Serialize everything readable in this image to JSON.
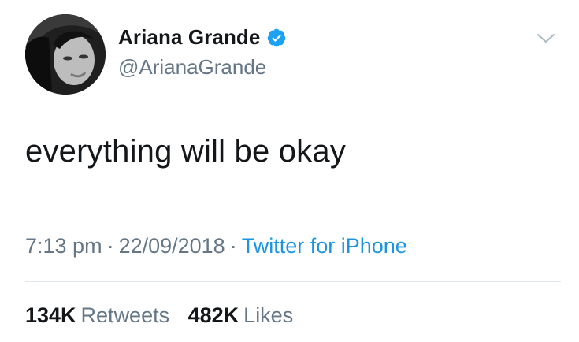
{
  "user": {
    "display_name": "Ariana Grande",
    "handle": "@ArianaGrande",
    "verified": true
  },
  "tweet": {
    "text": "everything will be okay",
    "time": "7:13 pm",
    "date": "22/09/2018",
    "source": "Twitter for iPhone",
    "separator": "·"
  },
  "stats": {
    "retweets_count": "134K",
    "retweets_label": "Retweets",
    "likes_count": "482K",
    "likes_label": "Likes"
  },
  "icons": {
    "verified": "verified-badge-icon",
    "menu": "chevron-down-icon"
  },
  "colors": {
    "primary_text": "#14171a",
    "secondary_text": "#657786",
    "link": "#1b95e0",
    "verified": "#1da1f2",
    "divider": "#e1e8ed"
  }
}
